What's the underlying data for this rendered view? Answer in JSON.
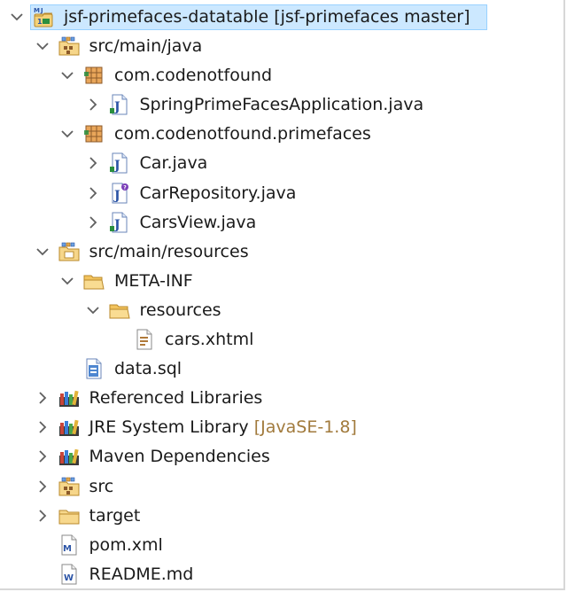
{
  "tree": {
    "items": [
      {
        "label": "jsf-primefaces-datatable [jsf-primefaces master]",
        "depth": 0,
        "expander": "expanded",
        "icon": "maven-project-icon",
        "selected": true
      },
      {
        "label": "src/main/java",
        "depth": 1,
        "expander": "expanded",
        "icon": "source-folder-icon"
      },
      {
        "label": "com.codenotfound",
        "depth": 2,
        "expander": "expanded",
        "icon": "package-icon"
      },
      {
        "label": "SpringPrimeFacesApplication.java",
        "depth": 3,
        "expander": "collapsed",
        "icon": "java-file-icon"
      },
      {
        "label": "com.codenotfound.primefaces",
        "depth": 2,
        "expander": "expanded",
        "icon": "package-icon"
      },
      {
        "label": "Car.java",
        "depth": 3,
        "expander": "collapsed",
        "icon": "java-file-icon"
      },
      {
        "label": "CarRepository.java",
        "depth": 3,
        "expander": "collapsed",
        "icon": "java-interface-file-icon"
      },
      {
        "label": "CarsView.java",
        "depth": 3,
        "expander": "collapsed",
        "icon": "java-file-icon"
      },
      {
        "label": "src/main/resources",
        "depth": 1,
        "expander": "expanded",
        "icon": "resource-folder-icon"
      },
      {
        "label": "META-INF",
        "depth": 2,
        "expander": "expanded",
        "icon": "open-folder-icon"
      },
      {
        "label": "resources",
        "depth": 3,
        "expander": "expanded",
        "icon": "open-folder-icon"
      },
      {
        "label": "cars.xhtml",
        "depth": 4,
        "expander": "none",
        "icon": "xhtml-file-icon"
      },
      {
        "label": "data.sql",
        "depth": 2,
        "expander": "none",
        "icon": "sql-file-icon"
      },
      {
        "label": "Referenced Libraries",
        "depth": 1,
        "expander": "collapsed",
        "icon": "library-icon"
      },
      {
        "label": "JRE System Library",
        "decoration": "[JavaSE-1.8]",
        "depth": 1,
        "expander": "collapsed",
        "icon": "library-icon"
      },
      {
        "label": "Maven Dependencies",
        "depth": 1,
        "expander": "collapsed",
        "icon": "library-icon"
      },
      {
        "label": "src",
        "depth": 1,
        "expander": "collapsed",
        "icon": "source-folder-icon"
      },
      {
        "label": "target",
        "depth": 1,
        "expander": "collapsed",
        "icon": "folder-icon"
      },
      {
        "label": "pom.xml",
        "depth": 1,
        "expander": "none",
        "icon": "xml-file-icon"
      },
      {
        "label": "README.md",
        "depth": 1,
        "expander": "none",
        "icon": "markdown-file-icon"
      }
    ]
  },
  "colors": {
    "selection_fill": "#cce8ff",
    "selection_border": "#99d1ff",
    "decoration_text": "#a17a3c",
    "chevron": "#5f5f5f"
  }
}
